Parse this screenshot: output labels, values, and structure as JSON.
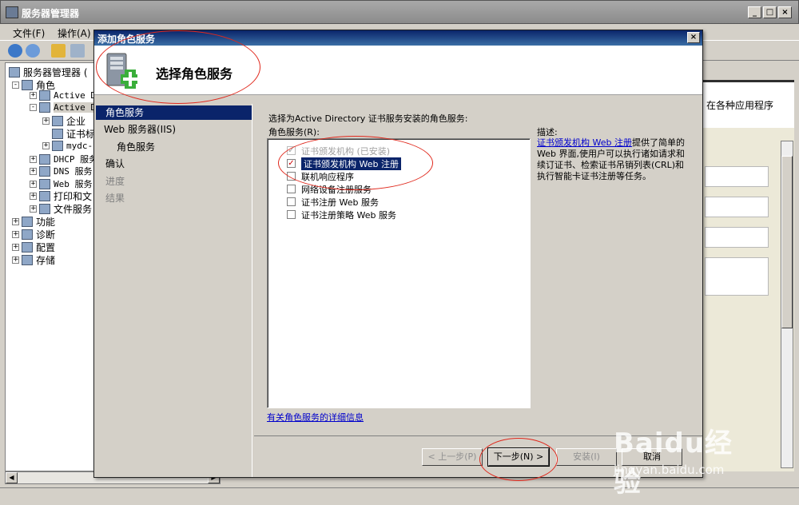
{
  "window": {
    "title": "服务器管理器",
    "controls": [
      "_",
      "□",
      "×"
    ]
  },
  "menubar": {
    "items": [
      "文件(F)",
      "操作(A)"
    ]
  },
  "tree": {
    "root": "服务器管理器 (",
    "roles": "角色",
    "active1": "Active D",
    "active2": "Active D",
    "enterprise": "企业",
    "cert": "证书标",
    "mydc": "mydc-",
    "dhcp": "DHCP 服务",
    "dns": "DNS 服务",
    "web": "Web 服务",
    "print": "打印和文",
    "file": "文件服务",
    "features": "功能",
    "diagnostics": "诊断",
    "config": "配置",
    "storage": "存储"
  },
  "right_pane": {
    "text": "在各种应用程序"
  },
  "dialog": {
    "title": "添加角色服务",
    "heading": "选择角色服务",
    "nav": [
      "角色服务",
      "Web 服务器(IIS)",
      "角色服务",
      "确认",
      "进度",
      "结果"
    ],
    "prompt": "选择为Active Directory 证书服务安装的角色服务:",
    "list_label": "角色服务(R):",
    "roles": [
      {
        "label": "证书颁发机构  (已安装)",
        "checked": true,
        "disabled": true
      },
      {
        "label": "证书颁发机构 Web 注册",
        "checked": true,
        "disabled": false
      },
      {
        "label": "联机响应程序",
        "checked": false,
        "disabled": false
      },
      {
        "label": "网络设备注册服务",
        "checked": false,
        "disabled": false
      },
      {
        "label": "证书注册 Web 服务",
        "checked": false,
        "disabled": false
      },
      {
        "label": "证书注册策略 Web 服务",
        "checked": false,
        "disabled": false
      }
    ],
    "desc_label": "描述:",
    "desc_link": "证书颁发机构 Web 注册",
    "desc_text": "提供了简单的 Web 界面,使用户可以执行诸如请求和续订证书、检索证书吊销列表(CRL)和执行智能卡证书注册等任务。",
    "more_link": "有关角色服务的详细信息",
    "buttons": {
      "prev": "< 上一步(P)",
      "next": "下一步(N) >",
      "install": "安装(I)",
      "cancel": "取消"
    }
  },
  "watermark": {
    "brand": "Baidu经验",
    "url": "jingyan.baidu.com"
  },
  "colors": {
    "selection": "#0a246a",
    "annotation": "#e0281c",
    "link": "#0000cc"
  }
}
